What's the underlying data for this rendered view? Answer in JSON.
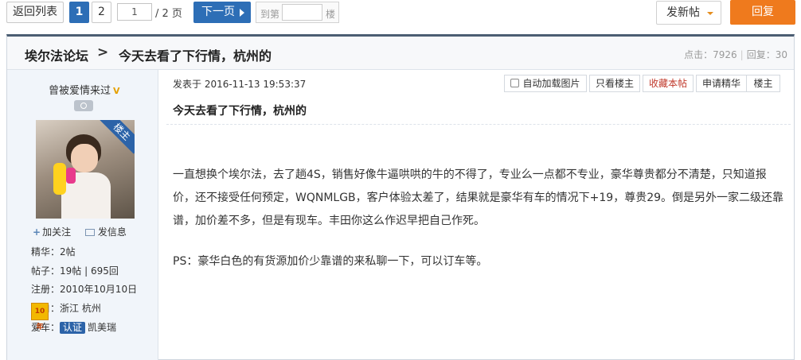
{
  "toolbar": {
    "back_label": "返回列表",
    "current_page": "1",
    "page2_label": "2",
    "page_input": "1",
    "page_total": "/ 2 页",
    "next_label": "下一页",
    "goto_label": "到第",
    "goto_floor": "楼",
    "new_post_label": "发新帖",
    "reply_label": "回复"
  },
  "thread": {
    "forum": "埃尔法论坛",
    "separator": ">",
    "title": "今天去看了下行情，杭州的",
    "views_label": "点击：7926",
    "replies_label": "回复：30"
  },
  "user": {
    "name": "曾被爱情来过",
    "vip_mark": "V",
    "op_badge": "楼主",
    "follow_label": "加关注",
    "message_label": "发信息",
    "essence": "精华：2帖",
    "posts": "帖子：19帖 | 695回",
    "registered": "注册：2010年10月10日",
    "from": "来自：浙江  杭州",
    "car_key": "爱车：",
    "car_cert": "认证",
    "car_model": "凯美瑞",
    "medal_label": "10年"
  },
  "post": {
    "posted_at": "发表于  2016-11-13  19:53:37",
    "auto_load_images": "自动加载图片",
    "only_op": "只看楼主",
    "favorite": "收藏本帖",
    "apply_essence": "申请精华",
    "floor": "楼主",
    "title": "今天去看了下行情，杭州的",
    "paragraph1": "一直想换个埃尔法，去了趟4S，销售好像牛逼哄哄的牛的不得了，专业么一点都不专业，豪华尊贵都分不清楚，只知道报价，还不接受任何预定，WQNMLGB，客户体验太差了，结果就是豪华有车的情况下+19，尊贵29。倒是另外一家二级还靠谱，加价差不多，但是有现车。丰田你这么作迟早把自己作死。",
    "paragraph2": "PS：豪华白色的有货源加价少靠谱的来私聊一下，可以订车等。"
  },
  "colors": {
    "accent_blue": "#2d6eb6",
    "reply_orange": "#ef7a1d",
    "sidebar_bg": "#f1f5fa"
  }
}
